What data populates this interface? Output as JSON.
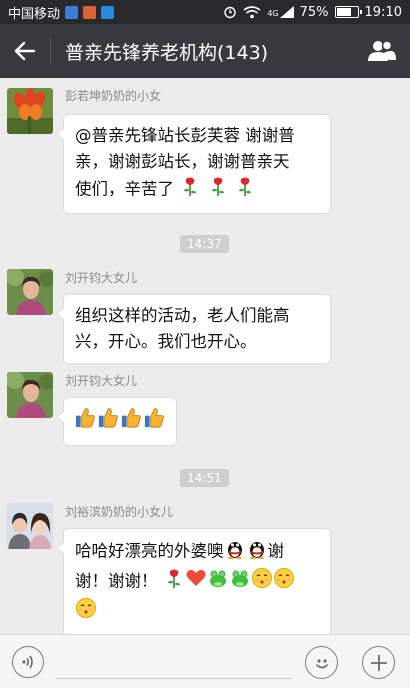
{
  "status_bar": {
    "carrier": "中国移动",
    "network": "4G",
    "battery": "75%",
    "battery_level": 0.75,
    "time": "19:10"
  },
  "header": {
    "title": "普亲先锋养老机构(143)",
    "back_icon": "back-arrow-icon",
    "members_icon": "group-members-icon"
  },
  "messages": [
    {
      "sender": "彭若坤奶奶的小女",
      "lines": [
        "@普亲先锋站长彭芙蓉 谢谢普",
        "亲，谢谢彭站长，谢谢普亲天",
        "使们，辛苦了"
      ],
      "emoji": [
        "rose",
        "rose",
        "rose"
      ]
    },
    {
      "time": "14:37"
    },
    {
      "sender": "刘开钧大女儿",
      "lines": [
        "组织这样的活动，老人们能高",
        "兴，开心。我们也开心。"
      ],
      "emoji": []
    },
    {
      "sender": "刘开钧大女儿",
      "lines": [],
      "emoji": [
        "thumbs-up",
        "thumbs-up",
        "thumbs-up",
        "thumbs-up"
      ]
    },
    {
      "time": "14:51"
    },
    {
      "sender": "刘裕滨奶奶的小女儿",
      "lines": [
        "哈哈好漂亮的外婆噢",
        "谢",
        "谢！谢谢！"
      ],
      "emoji_mid": [
        "penguin",
        "penguin"
      ],
      "emoji_end": [
        "rose",
        "heart",
        "frog",
        "frog",
        "kiss",
        "kiss"
      ],
      "emoji_last": [
        "kiss"
      ]
    }
  ],
  "input": {
    "placeholder": "",
    "voice_icon": "voice-icon",
    "emoji_icon": "emoji-icon",
    "plus_icon": "plus-icon"
  },
  "colors": {
    "header_bg": "#393a3f",
    "status_bg": "#2a2a2d",
    "chat_bg": "#ebebeb"
  }
}
